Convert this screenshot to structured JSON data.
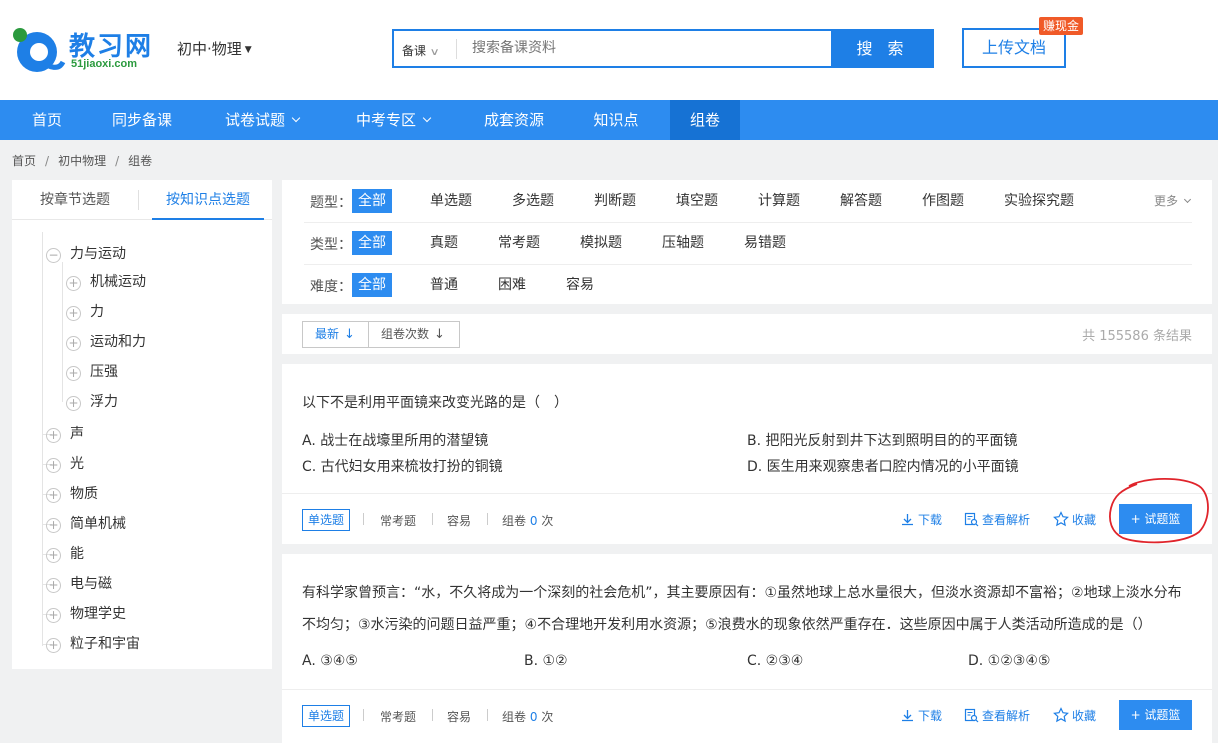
{
  "header": {
    "logo_text": "教习网",
    "logo_sub": "51jiaoxi.com",
    "subject": "初中·物理",
    "search_category": "备课",
    "search_placeholder": "搜索备课资料",
    "search_button": "搜 索",
    "upload_button": "上传文档",
    "upload_badge": "赚现金"
  },
  "nav": {
    "items": [
      {
        "label": "首页"
      },
      {
        "label": "同步备课"
      },
      {
        "label": "试卷试题"
      },
      {
        "label": "中考专区"
      },
      {
        "label": "成套资源"
      },
      {
        "label": "知识点"
      },
      {
        "label": "组卷"
      }
    ]
  },
  "breadcrumb": [
    "首页",
    "初中物理",
    "组卷"
  ],
  "sidebar": {
    "tabs": [
      "按章节选题",
      "按知识点选题"
    ],
    "tree": [
      {
        "label": "力与运动",
        "icon": "⊖"
      },
      {
        "label": "机械运动",
        "icon": "⊕"
      },
      {
        "label": "力",
        "icon": "⊕"
      },
      {
        "label": "运动和力",
        "icon": "⊕"
      },
      {
        "label": "压强",
        "icon": "⊕"
      },
      {
        "label": "浮力",
        "icon": "⊕"
      },
      {
        "label": "声",
        "icon": "⊕"
      },
      {
        "label": "光",
        "icon": "⊕"
      },
      {
        "label": "物质",
        "icon": "⊕"
      },
      {
        "label": "简单机械",
        "icon": "⊕"
      },
      {
        "label": "能",
        "icon": "⊕"
      },
      {
        "label": "电与磁",
        "icon": "⊕"
      },
      {
        "label": "物理学史",
        "icon": "⊕"
      },
      {
        "label": "粒子和宇宙",
        "icon": "⊕"
      }
    ]
  },
  "filters": {
    "type": {
      "label": "题型：",
      "options": [
        "全部",
        "单选题",
        "多选题",
        "判断题",
        "填空题",
        "计算题",
        "解答题",
        "作图题",
        "实验探究题"
      ]
    },
    "more": "更多",
    "category": {
      "label": "类型：",
      "options": [
        "全部",
        "真题",
        "常考题",
        "模拟题",
        "压轴题",
        "易错题"
      ]
    },
    "difficulty": {
      "label": "难度：",
      "options": [
        "全部",
        "普通",
        "困难",
        "容易"
      ]
    }
  },
  "sort": {
    "latest": "最新",
    "count": "组卷次数",
    "total": "共 155586 条结果"
  },
  "questions": [
    {
      "text": "以下不是利用平面镜来改变光路的是（　）",
      "options": [
        "A. 战士在战壕里所用的潜望镜",
        "B. 把阳光反射到井下达到照明目的的平面镜",
        "C. 古代妇女用来梳妆打扮的铜镜",
        "D. 医生用来观察患者口腔内情况的小平面镜"
      ],
      "tag": "单选题",
      "kind": "常考题",
      "difficulty": "容易",
      "used_prefix": "组卷",
      "used_count": "0",
      "used_suffix": "次"
    },
    {
      "text_line1": "有科学家曾预言：“水，不久将成为一个深刻的社会危机”，其主要原因有：①虽然地球上总水量很大，但淡水资源却不富裕；②地球上淡水分布",
      "text_line2": "不均匀；③水污染的问题日益严重；④不合理地开发利用水资源；⑤浪费水的现象依然严重存在．这些原因中属于人类活动所造成的是（）",
      "options": [
        "A. ③④⑤",
        "B. ①②",
        "C. ②③④",
        "D. ①②③④⑤"
      ],
      "tag": "单选题",
      "kind": "常考题",
      "difficulty": "容易",
      "used_prefix": "组卷",
      "used_count": "0",
      "used_suffix": "次"
    }
  ],
  "actions": {
    "download": "下载",
    "analysis": "查看解析",
    "favorite": "收藏",
    "basket": "+ 试题篮"
  },
  "colors": {
    "primary": "#2d8cf0",
    "nav_active": "#1672d4",
    "badge": "#f05a28",
    "annotation": "#e0242b"
  }
}
